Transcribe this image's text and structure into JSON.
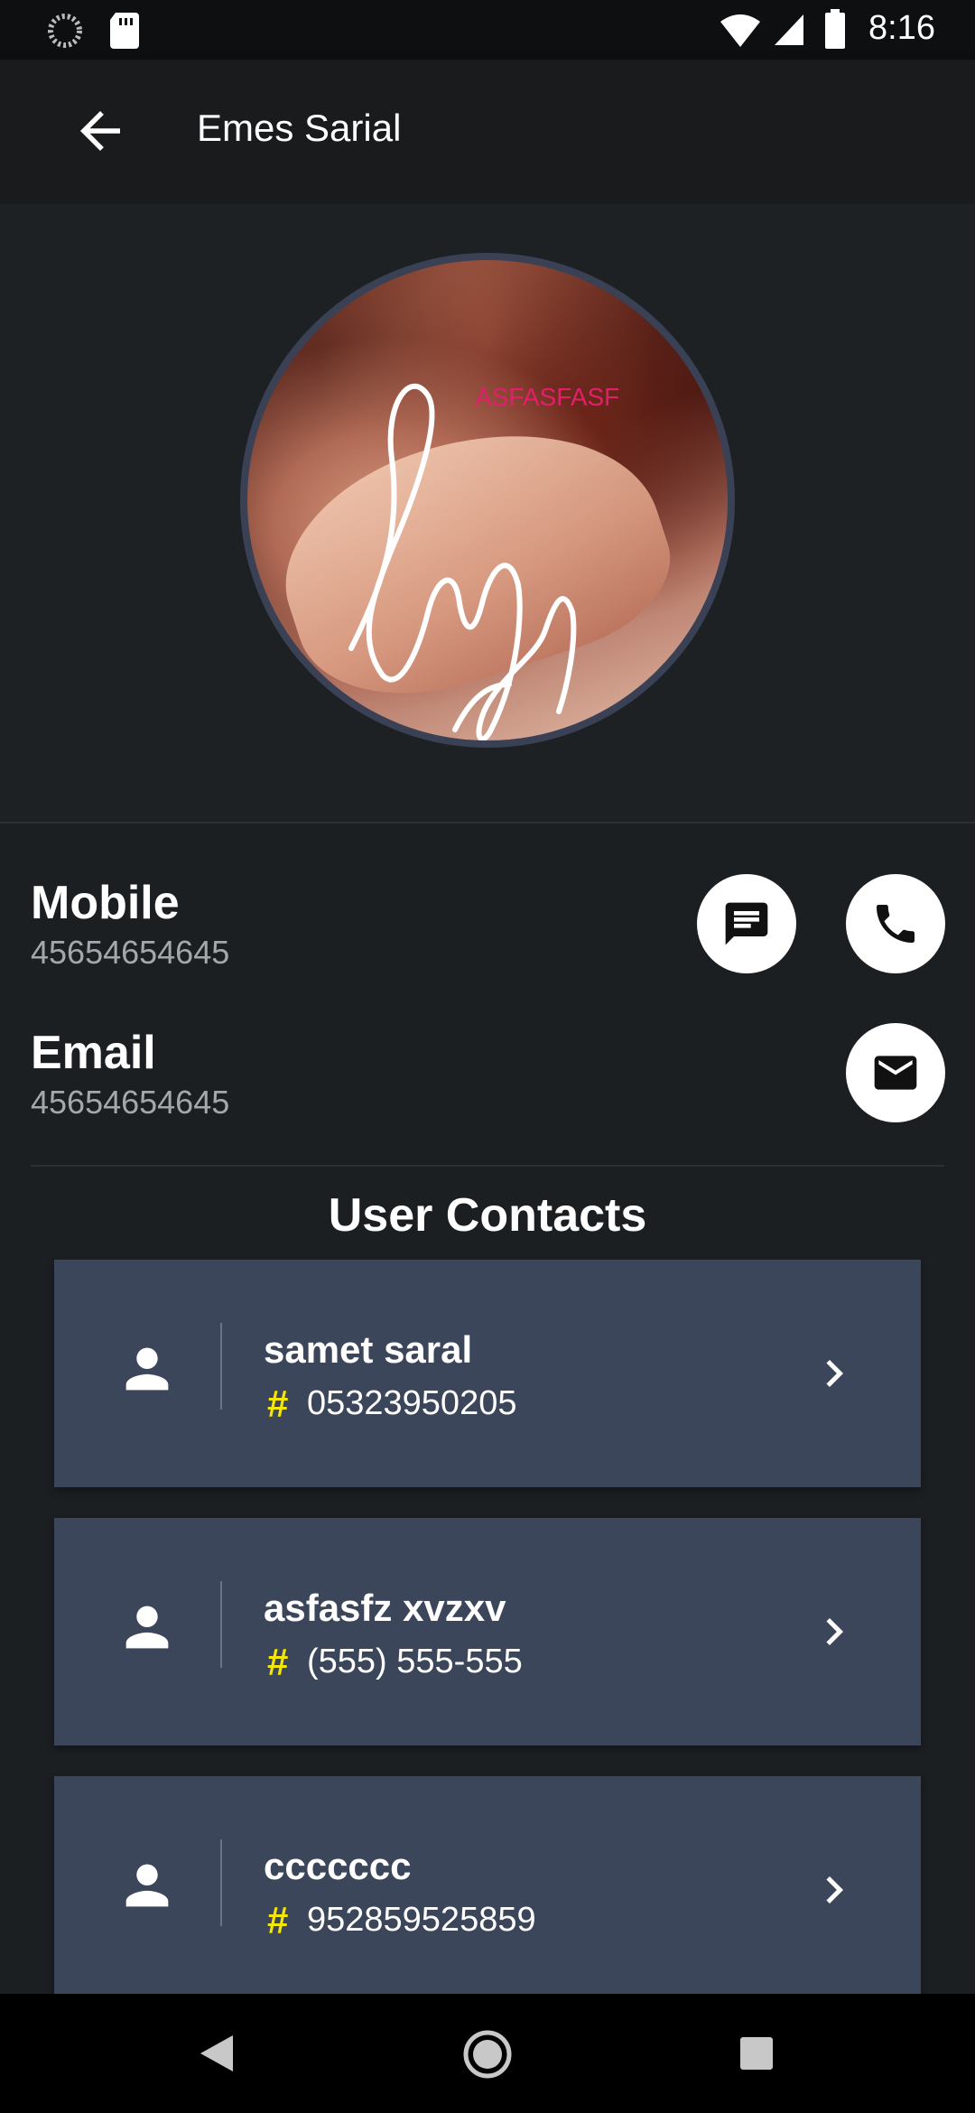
{
  "status_bar": {
    "time": "8:16"
  },
  "app_bar": {
    "title": "Emes Sarial"
  },
  "profile": {
    "photo_caption": "ASFASFASF"
  },
  "mobile": {
    "label": "Mobile",
    "value": "45654654645"
  },
  "email": {
    "label": "Email",
    "value": "45654654645"
  },
  "contacts_section": {
    "title": "User Contacts",
    "items": [
      {
        "name": "samet saral",
        "phone": "05323950205"
      },
      {
        "name": "asfasfz xvzxv",
        "phone": "(555) 555-555"
      },
      {
        "name": "ccccccc",
        "phone": "952859525859"
      }
    ],
    "hash_symbol": "#"
  },
  "colors": {
    "background": "#1c1f22",
    "card": "#3c465a",
    "hash_accent": "#f6e700",
    "caption_accent": "#e0206a"
  },
  "icons": [
    "back-arrow-icon",
    "message-icon",
    "phone-icon",
    "mail-icon",
    "person-icon",
    "chevron-right-icon",
    "nav-back-icon",
    "nav-home-icon",
    "nav-recents-icon"
  ]
}
